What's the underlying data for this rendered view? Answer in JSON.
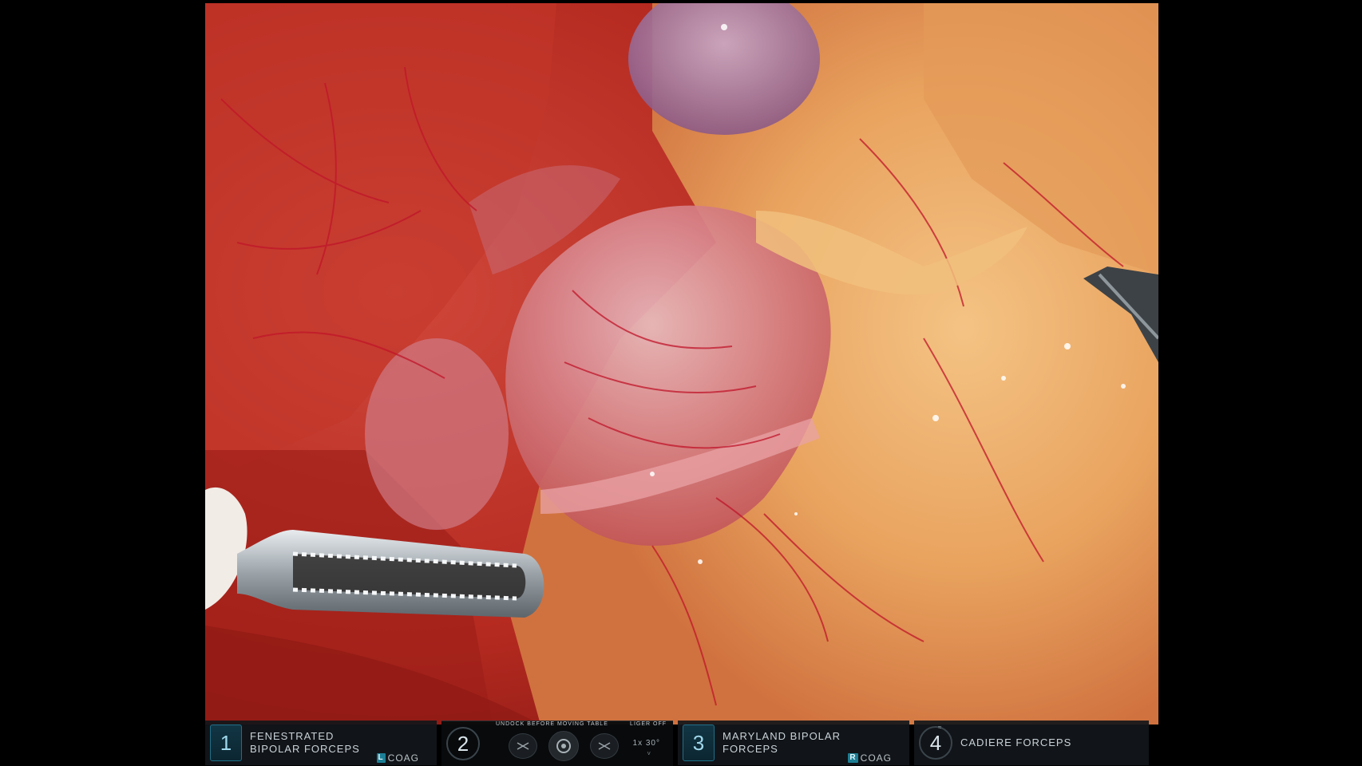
{
  "hud": {
    "arm1": {
      "number": "1",
      "tool_line1": "FENESTRATED",
      "tool_line2": "BIPOLAR FORCEPS",
      "energy_key": "L",
      "energy_mode": "COAG"
    },
    "arm2": {
      "number": "2",
      "notice_left": "UNDOCK BEFORE MOVING TABLE",
      "notice_right": "LIGER OFF",
      "scope_zoom": "1x",
      "scope_angle": "30°",
      "scope_arrow": "˅",
      "icons": [
        "instrument-x-icon",
        "camera-icon",
        "instrument-x-icon"
      ]
    },
    "arm3": {
      "number": "3",
      "tool_line1": "MARYLAND BIPOLAR",
      "tool_line2": "FORCEPS",
      "energy_key": "R",
      "energy_mode": "COAG"
    },
    "arm4": {
      "number": "4",
      "tool_line1": "CADIERE FORCEPS",
      "badge": "≈"
    }
  },
  "colors": {
    "hud_bg": "#12161a",
    "active_arm_accent": "#1f6f88",
    "energy_key_bg": "#1d7f95",
    "tissue_red": "#b3261f",
    "tissue_fat": "#e8a860"
  }
}
